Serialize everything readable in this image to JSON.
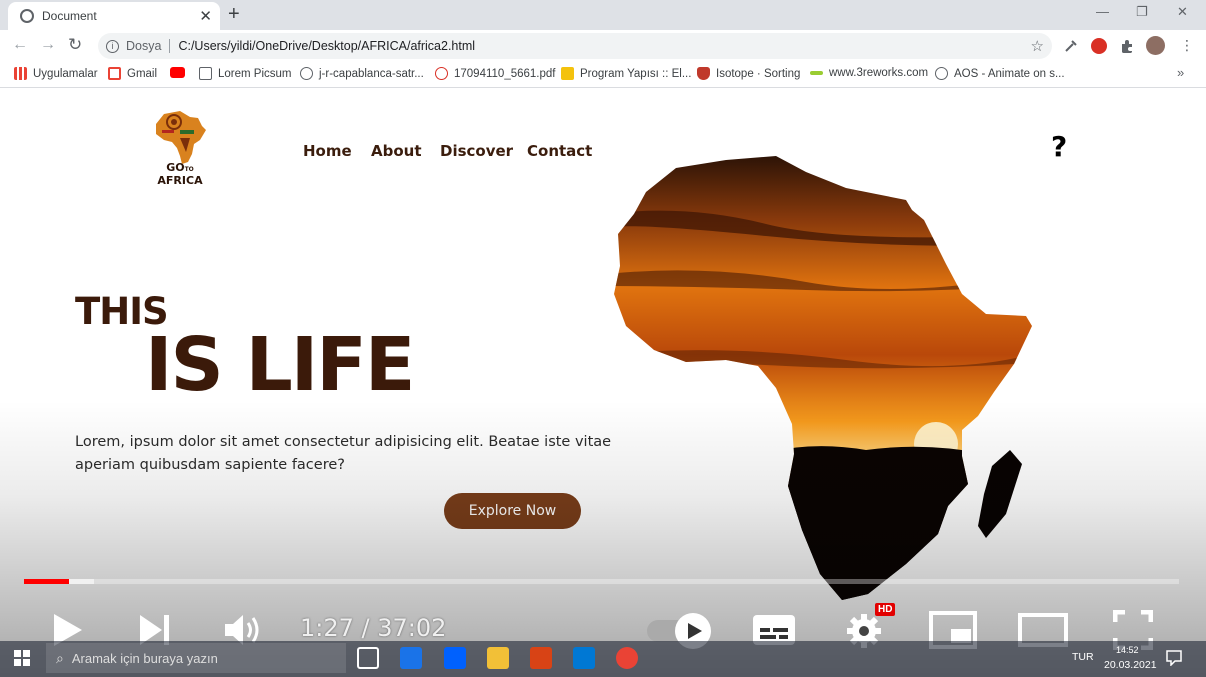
{
  "browser": {
    "tab_title": "Document",
    "new_tab": "+",
    "window_controls": {
      "minimize": "—",
      "restore": "❐",
      "close": "✕"
    },
    "address": {
      "scheme": "Dosya",
      "url": "C:/Users/yildi/OneDrive/Desktop/AFRICA/africa2.html"
    },
    "bookmarks": [
      {
        "label": "Uygulamalar",
        "icon": "apps-grid-icon",
        "color": "#ea4335"
      },
      {
        "label": "Gmail",
        "icon": "gmail-icon",
        "color": "#ea4335"
      },
      {
        "label": "",
        "icon": "youtube-icon",
        "color": "#ff0000"
      },
      {
        "label": "Lorem Picsum",
        "icon": "image-icon",
        "color": "#5f6368"
      },
      {
        "label": "j-r-capablanca-satr...",
        "icon": "globe-icon",
        "color": "#5f6368"
      },
      {
        "label": "17094110_5661.pdf",
        "icon": "pdf-icon",
        "color": "#d93025"
      },
      {
        "label": "Program Yapısı :: El...",
        "icon": "ejs-icon",
        "color": "#f4c20d"
      },
      {
        "label": "Isotope · Sorting",
        "icon": "isotope-icon",
        "color": "#c0392b"
      },
      {
        "label": "www.3reworks.com",
        "icon": "3reworks-icon",
        "color": "#9acd32"
      },
      {
        "label": "AOS - Animate on s...",
        "icon": "globe-icon",
        "color": "#5f6368"
      }
    ],
    "bookmarks_more": "»"
  },
  "site": {
    "logo_text_line1": "GO",
    "logo_text_small": "TO",
    "logo_text_line2": "AFRICA",
    "nav": [
      "Home",
      "About",
      "Discover",
      "Contact"
    ],
    "help_icon": "?",
    "hero_line1": "THIS",
    "hero_line2": "IS LIFE",
    "hero_text": "Lorem, ipsum dolor sit amet consectetur adipisicing elit. Beatae iste vitae aperiam quibusdam sapiente facere?",
    "cta": "Explore Now"
  },
  "player": {
    "time": "1:27 / 37:02",
    "played_fraction": 0.039,
    "buffered_fraction": 0.061,
    "hd_label": "HD",
    "accent": "#ff0000"
  },
  "taskbar": {
    "search_placeholder": "Aramak için buraya yazın",
    "language": "TUR",
    "clock_time": "14:52",
    "clock_date": "20.03.2021"
  }
}
